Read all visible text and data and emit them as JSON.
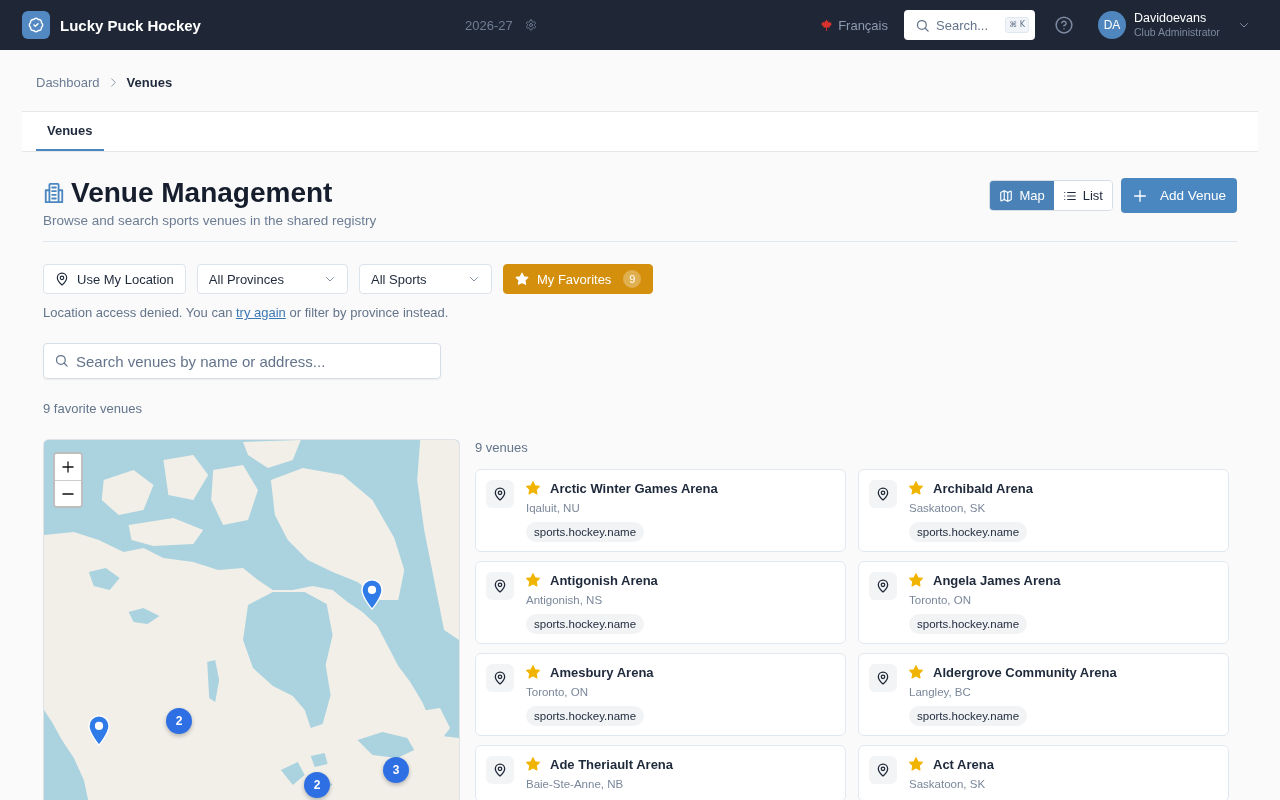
{
  "header": {
    "app_name": "Lucky Puck Hockey",
    "season": "2026-27",
    "language": "Français",
    "search": {
      "label": "Search...",
      "shortcut": "⌘ K"
    },
    "user": {
      "initials": "DA",
      "name": "Davidoevans",
      "role": "Club Administrator"
    }
  },
  "breadcrumb": [
    {
      "label": "Dashboard",
      "current": false
    },
    {
      "label": "Venues",
      "current": true
    }
  ],
  "tabs": [
    {
      "label": "Venues",
      "selected": true
    }
  ],
  "page": {
    "title": "Venue Management",
    "subtitle": "Browse and search sports venues in the shared registry"
  },
  "view_toggle": [
    {
      "kind": "map",
      "label": "Map",
      "selected": true
    },
    {
      "kind": "list",
      "label": "List",
      "selected": false
    }
  ],
  "add_button": "Add Venue",
  "filters": [
    {
      "kind": "location",
      "label": "Use My Location"
    },
    {
      "kind": "select",
      "value": "All Provinces"
    },
    {
      "kind": "select",
      "value": "All Sports"
    },
    {
      "kind": "favorites",
      "label": "My Favorites",
      "count": "9",
      "on": true
    }
  ],
  "location_notice": {
    "before": "Location access denied. You can ",
    "link": "try again",
    "after": " or filter by province instead."
  },
  "venue_search": {
    "placeholder": "Search venues by name or address..."
  },
  "favorites_summary": "9 favorite venues",
  "map": {
    "markers": [
      {
        "kind": "pin"
      },
      {
        "kind": "cluster",
        "count": "2"
      },
      {
        "kind": "pin"
      },
      {
        "kind": "cluster",
        "count": "3"
      },
      {
        "kind": "cluster",
        "count": "2"
      }
    ]
  },
  "results": {
    "count_label": "9 venues",
    "venues": [
      {
        "name": "Arctic Winter Games Arena",
        "location": "Iqaluit, NU",
        "favorite": true,
        "tags": [
          "sports.hockey.name"
        ]
      },
      {
        "name": "Archibald Arena",
        "location": "Saskatoon, SK",
        "favorite": true,
        "tags": [
          "sports.hockey.name"
        ]
      },
      {
        "name": "Antigonish Arena",
        "location": "Antigonish, NS",
        "favorite": true,
        "tags": [
          "sports.hockey.name"
        ]
      },
      {
        "name": "Angela James Arena",
        "location": "Toronto, ON",
        "favorite": true,
        "tags": [
          "sports.hockey.name"
        ]
      },
      {
        "name": "Amesbury Arena",
        "location": "Toronto, ON",
        "favorite": true,
        "tags": [
          "sports.hockey.name"
        ]
      },
      {
        "name": "Aldergrove Community Arena",
        "location": "Langley, BC",
        "favorite": true,
        "tags": [
          "sports.hockey.name"
        ]
      },
      {
        "name": "Ade Theriault Arena",
        "location": "Baie-Ste-Anne, NB",
        "favorite": true
      },
      {
        "name": "Act Arena",
        "location": "Saskatoon, SK",
        "favorite": true
      }
    ]
  }
}
